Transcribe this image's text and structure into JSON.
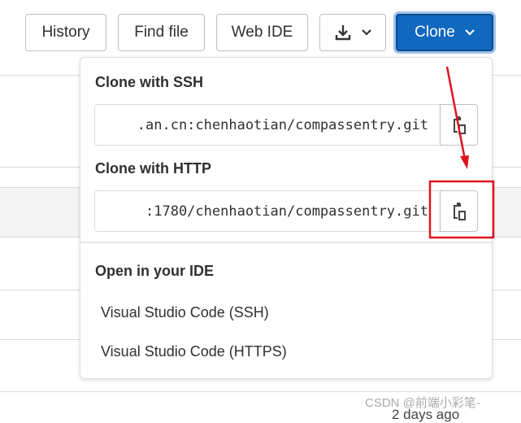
{
  "toolbar": {
    "history": "History",
    "find_file": "Find file",
    "web_ide": "Web IDE",
    "download_icon": "download-icon",
    "clone": "Clone"
  },
  "dropdown": {
    "ssh_label": "Clone with SSH",
    "ssh_url": ".an.cn:chenhaotian/compassentry.git",
    "http_label": "Clone with HTTP",
    "http_url": ":1780/chenhaotian/compassentry.git",
    "ide_label": "Open in your IDE",
    "ide_items": [
      "Visual Studio Code (SSH)",
      "Visual Studio Code (HTTPS)"
    ]
  },
  "background": {
    "time_text": "2 days ago"
  },
  "watermark": "CSDN @前端小彩笔-",
  "colors": {
    "accent": "#1068bf",
    "annotation": "#e0141e"
  }
}
